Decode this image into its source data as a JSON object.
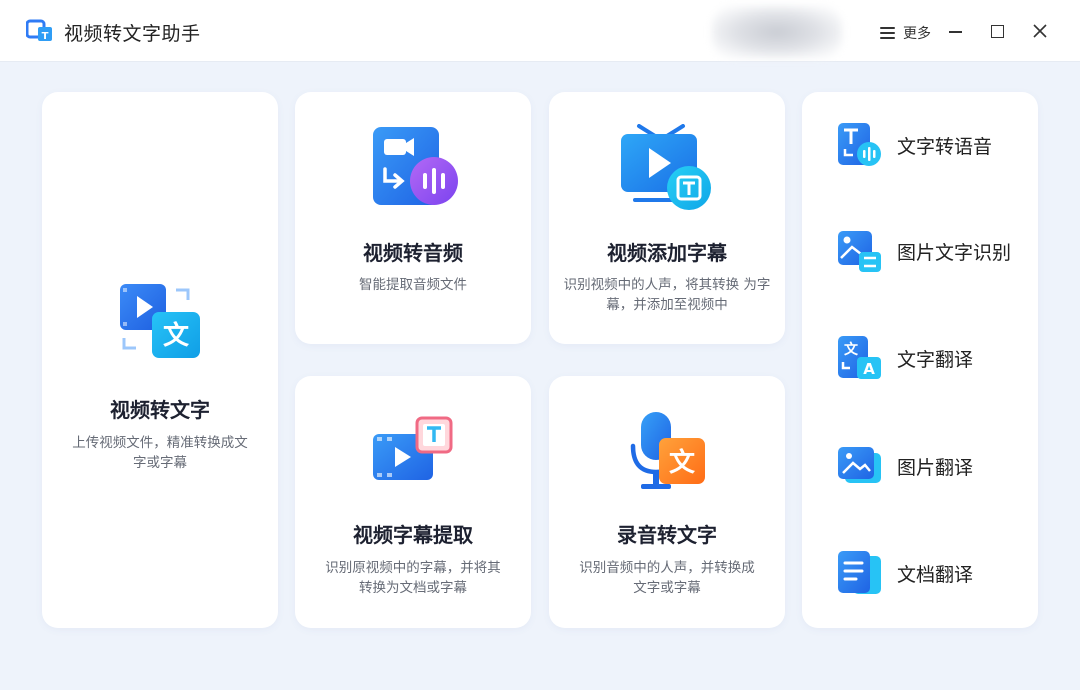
{
  "app": {
    "title": "视频转文字助手"
  },
  "header": {
    "menu_label": "更多"
  },
  "cards": {
    "video_to_text": {
      "title": "视频转文字",
      "desc_line1": "上传视频文件，精准转换成文",
      "desc_line2": "字或字幕"
    },
    "video_to_audio": {
      "title": "视频转音频",
      "desc_line1": "智能提取音频文件"
    },
    "video_add_subtitle": {
      "title": "视频添加字幕",
      "desc_line1": "识别视频中的人声，将其转换 为字",
      "desc_line2": "幕，并添加至视频中"
    },
    "subtitle_extract": {
      "title": "视频字幕提取",
      "desc_line1": "识别原视频中的字幕，并将其",
      "desc_line2": "转换为文档或字幕"
    },
    "audio_to_text": {
      "title": "录音转文字",
      "desc_line1": "识别音频中的人声，并转换成",
      "desc_line2": "文字或字幕"
    }
  },
  "icon_glyphs": {
    "wen": "文",
    "T": "T",
    "A": "A"
  },
  "tools": [
    {
      "label": "文字转语音",
      "icon": "text-to-speech-icon"
    },
    {
      "label": "图片文字识别",
      "icon": "image-ocr-icon"
    },
    {
      "label": "文字翻译",
      "icon": "text-translate-icon"
    },
    {
      "label": "图片翻译",
      "icon": "image-translate-icon"
    },
    {
      "label": "文档翻译",
      "icon": "document-translate-icon"
    }
  ],
  "colors": {
    "accent_blue": "#2f7bf5",
    "background": "#eef3fb",
    "card_bg": "#ffffff",
    "purple": "#8a4cf0",
    "orange": "#ff7a1a"
  }
}
